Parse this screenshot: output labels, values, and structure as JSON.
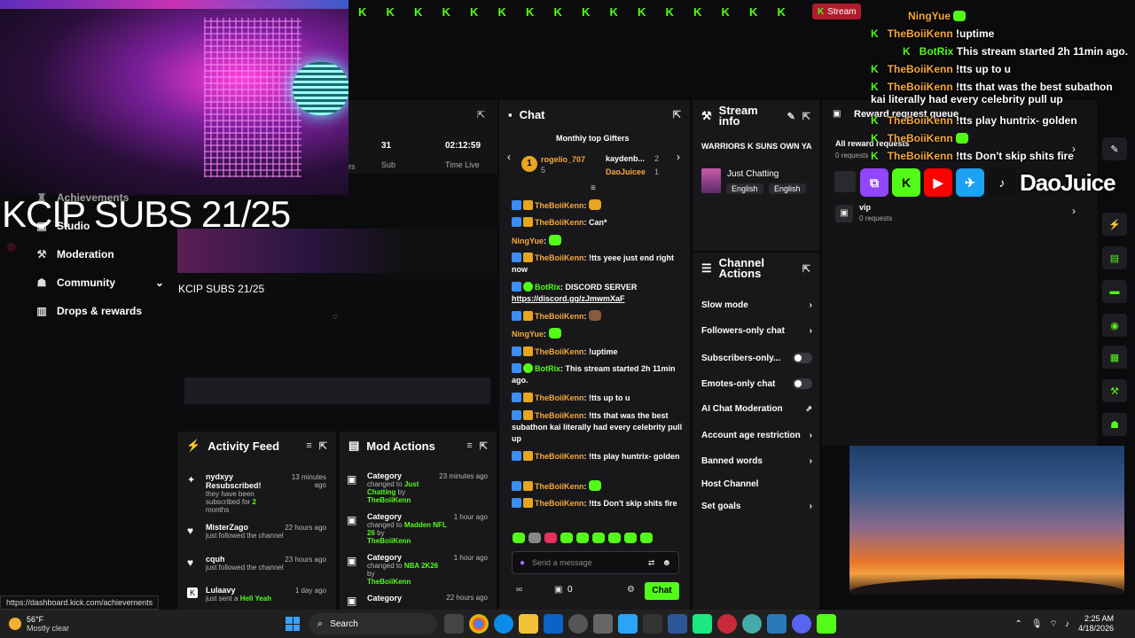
{
  "overlay": {
    "title": "KCIP SUBS 21/25",
    "preview_title": "KCIP SUBS 21/25",
    "stream_button": "Stream",
    "chat": [
      {
        "user": "NingYue",
        "text": ""
      },
      {
        "user": "TheBoiiKenn",
        "text": "!uptime"
      },
      {
        "user": "BotRix",
        "text": "This stream started 2h 11min ago."
      },
      {
        "user": "TheBoiiKenn",
        "text": "!tts up to u"
      },
      {
        "user": "TheBoiiKenn",
        "text": "!tts that was the best subathon kai literally had every celebrity pull up"
      },
      {
        "user": "TheBoiiKenn",
        "text": "!tts play huntrix- golden"
      },
      {
        "user": "TheBoiiKenn",
        "text": ""
      },
      {
        "user": "TheBoiiKenn",
        "text": "!tts Don't skip shits fire"
      }
    ],
    "brand": "DaoJuice"
  },
  "left_nav": {
    "achievements": "Achievements",
    "studio": "Studio",
    "moderation": "Moderation",
    "community": "Community",
    "drops": "Drops & rewards"
  },
  "stats": {
    "followers_label": "rs",
    "subs_value": "31",
    "subs_label": "Sub",
    "time_value": "02:12:59",
    "time_label": "Time Live"
  },
  "chat_panel": {
    "title": "Chat",
    "top_gifters_label": "Monthly top Gifters",
    "gifters": [
      {
        "rank": "1",
        "name": "rogelio_707",
        "count": "5"
      },
      {
        "rank": "",
        "name": "kaydenb...",
        "count": "2"
      },
      {
        "rank": "",
        "name": "DaoJuicee",
        "count": "1"
      }
    ],
    "messages": [
      {
        "user": "TheBoiiKenn",
        "text": ""
      },
      {
        "user": "TheBoiiKenn",
        "text": "Can*"
      },
      {
        "user": "NingYue",
        "text": ""
      },
      {
        "user": "TheBoiiKenn",
        "text": "!tts yeee just end right now"
      },
      {
        "user": "BotRix",
        "text": "DISCORD SERVER",
        "link": "https://discord.gg/zJmwmXaF"
      },
      {
        "user": "TheBoiiKenn",
        "text": ""
      },
      {
        "user": "NingYue",
        "text": ""
      },
      {
        "user": "TheBoiiKenn",
        "text": "!uptime"
      },
      {
        "user": "BotRix",
        "text": "This stream started 2h 11min ago."
      },
      {
        "user": "TheBoiiKenn",
        "text": "!tts up to u"
      },
      {
        "user": "TheBoiiKenn",
        "text": "!tts that was the best subathon kai literally had every celebrity pull up"
      },
      {
        "user": "TheBoiiKenn",
        "text": "!tts play huntrix- golden"
      },
      {
        "user": "TheBoiiKenn",
        "text": ""
      },
      {
        "user": "TheBoiiKenn",
        "text": "!tts Don't skip shits fire"
      }
    ],
    "input_placeholder": "Send a message",
    "viewers_count": "0",
    "send_label": "Chat"
  },
  "stream_info": {
    "title": "Stream info",
    "stream_title": "WARRIORS K SUNS OWN YA",
    "category": "Just Chatting",
    "tags": [
      "English",
      "English"
    ]
  },
  "channel_actions": {
    "title": "Channel Actions",
    "items": [
      {
        "label": "Slow mode",
        "control": "chevron"
      },
      {
        "label": "Followers-only chat",
        "control": "chevron"
      },
      {
        "label": "Subscribers-only...",
        "control": "toggle"
      },
      {
        "label": "Emotes-only chat",
        "control": "toggle"
      },
      {
        "label": "AI Chat Moderation",
        "control": "external"
      },
      {
        "label": "Account age restriction",
        "control": "chevron"
      },
      {
        "label": "Banned words",
        "control": "chevron"
      },
      {
        "label": "Host Channel",
        "control": "none"
      },
      {
        "label": "Set goals",
        "control": "chevron"
      }
    ]
  },
  "reward_queue": {
    "title": "Reward request queue",
    "all_label": "All reward requests",
    "all_count": "0 requests",
    "vip_label": "vip",
    "vip_count": "0 requests"
  },
  "activity_feed": {
    "title": "Activity Feed",
    "items": [
      {
        "name": "nydxyy",
        "action": "Resubscribed!",
        "detail": "they have been subscribed for",
        "detail_hl": "2",
        "detail_end": "months",
        "time": "13 minutes ago"
      },
      {
        "name": "MisterZago",
        "action": "",
        "detail": "just followed the channel",
        "time": "22 hours ago"
      },
      {
        "name": "cquh",
        "action": "",
        "detail": "just followed the channel",
        "time": "23 hours ago"
      },
      {
        "name": "Lulaavy",
        "action": "",
        "detail": "just sent a",
        "detail_hl": "Hell Yeah",
        "time": "1 day ago"
      }
    ]
  },
  "mod_actions": {
    "title": "Mod Actions",
    "items": [
      {
        "name": "Category",
        "changed": "changed to",
        "value": "Just Chatting",
        "by": "by",
        "user": "TheBoiiKenn",
        "time": "23 minutes ago"
      },
      {
        "name": "Category",
        "changed": "changed to",
        "value": "Madden NFL 26",
        "by": "by",
        "user": "TheBoiiKenn",
        "time": "1 hour ago"
      },
      {
        "name": "Category",
        "changed": "changed to",
        "value": "NBA 2K26",
        "by": "by",
        "user": "TheBoiiKenn",
        "time": "1 hour ago"
      },
      {
        "name": "Category",
        "changed": "",
        "value": "",
        "by": "",
        "user": "",
        "time": "22 hours ago"
      }
    ]
  },
  "status_url": "https://dashboard.kick.com/achievements",
  "taskbar": {
    "weather_temp": "56°F",
    "weather_desc": "Mostly clear",
    "search_label": "Search",
    "time": "2:25 AM",
    "date": "4/18/2026"
  },
  "colors": {
    "accent": "#53fc18",
    "panel": "#18181b",
    "username": "#f7a83b"
  }
}
